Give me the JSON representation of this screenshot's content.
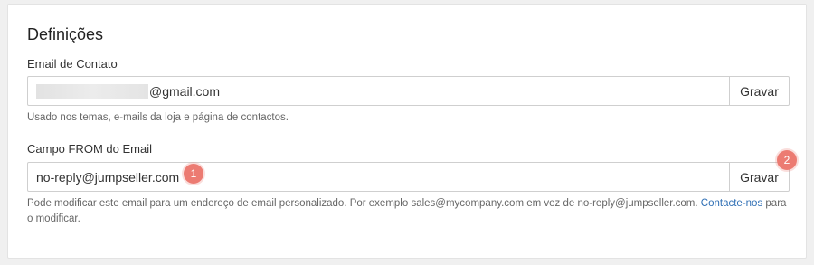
{
  "settings": {
    "title": "Definições",
    "contact_email": {
      "label": "Email de Contato",
      "value_suffix": "@gmail.com",
      "save_label": "Gravar",
      "help": "Usado nos temas, e-mails da loja e página de contactos."
    },
    "from_email": {
      "label": "Campo FROM do Email",
      "value": "no-reply@jumpseller.com",
      "save_label": "Gravar",
      "help_before": "Pode modificar este email para um endereço de email personalizado. Por exemplo sales@mycompany.com em vez de no-reply@jumpseller.com.",
      "help_link": "Contacte-nos",
      "help_after": "para o modificar."
    }
  },
  "annotations": {
    "badge_1": "1",
    "badge_2": "2"
  },
  "colors": {
    "badge": "#ec7b72",
    "link": "#2f6fb5"
  }
}
